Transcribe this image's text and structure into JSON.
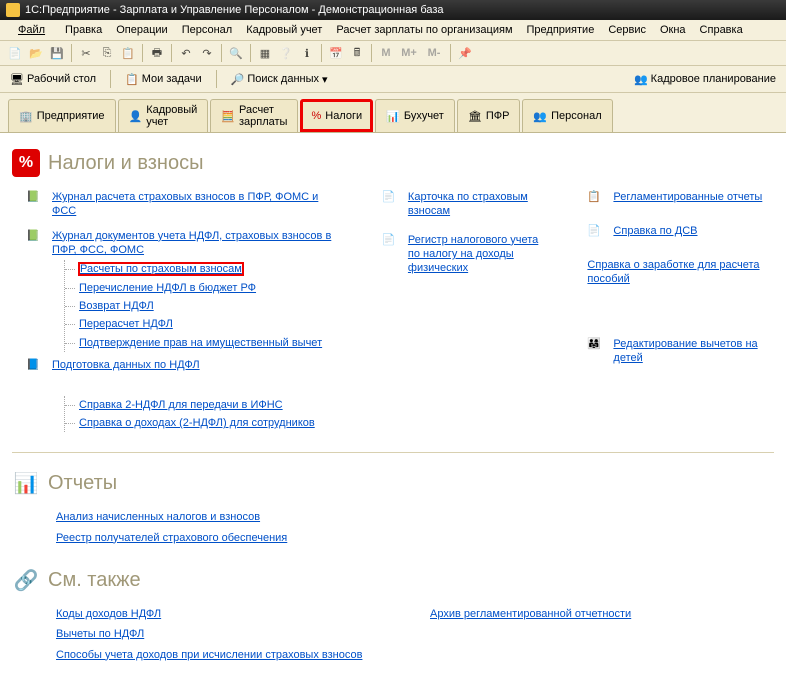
{
  "title": "1С:Предприятие - Зарплата и Управление Персоналом - Демонстрационная база",
  "menu": [
    "Файл",
    "Правка",
    "Операции",
    "Персонал",
    "Кадровый учет",
    "Расчет зарплаты по организациям",
    "Предприятие",
    "Сервис",
    "Окна",
    "Справка"
  ],
  "tb_text": {
    "m1": "M",
    "m2": "M+",
    "m3": "M-"
  },
  "tb2": {
    "desktop": "Рабочий стол",
    "tasks": "Мои задачи",
    "search": "Поиск данных"
  },
  "right_link": "Кадровое планирование",
  "tabs": [
    {
      "label": "Предприятие",
      "icon": "building"
    },
    {
      "label": "Кадровый учет",
      "icon": "person-blue",
      "multiline": [
        "Кадровый",
        "учет"
      ]
    },
    {
      "label": "Расчет зарплаты",
      "icon": "calc",
      "multiline": [
        "Расчет",
        "зарплаты"
      ]
    },
    {
      "label": "Налоги",
      "icon": "percent-red",
      "highlighted": true
    },
    {
      "label": "Бухучет",
      "icon": "abacus"
    },
    {
      "label": "ПФР",
      "icon": "pfr"
    },
    {
      "label": "Персонал",
      "icon": "person-group"
    }
  ],
  "sections": {
    "taxes": {
      "title": "Налоги и взносы",
      "col1": {
        "g1": "Журнал расчета страховых взносов в ПФР, ФОМС и ФСС",
        "g2": "Журнал документов учета НДФЛ, страховых взносов в ПФР, ФСС, ФОМС",
        "g2_children": [
          "Расчеты по страховым взносам",
          "Перечисление НДФЛ в бюджет РФ",
          "Возврат НДФЛ",
          "Перерасчет НДФЛ",
          "Подтверждение прав на имущественный вычет"
        ],
        "g3": "Подготовка данных по НДФЛ",
        "g3_children": [
          "Справка 2-НДФЛ для передачи в ИФНС",
          "Справка о доходах (2-НДФЛ) для сотрудников"
        ]
      },
      "col2": [
        "Карточка по страховым взносам",
        "Регистр налогового учета по налогу на доходы физических"
      ],
      "col3": [
        "Регламентированные отчеты",
        "Справка по ДСВ",
        "Справка о заработке для расчета пособий",
        "Редактирование вычетов на детей"
      ]
    },
    "reports": {
      "title": "Отчеты",
      "links": [
        "Анализ начисленных налогов и взносов",
        "Реестр получателей страхового обеспечения"
      ]
    },
    "seealso": {
      "title": "См. также",
      "col1": [
        "Коды доходов НДФЛ",
        "Вычеты по НДФЛ",
        "Способы учета доходов при исчислении страховых взносов"
      ],
      "col2": [
        "Архив регламентированной отчетности"
      ]
    }
  }
}
